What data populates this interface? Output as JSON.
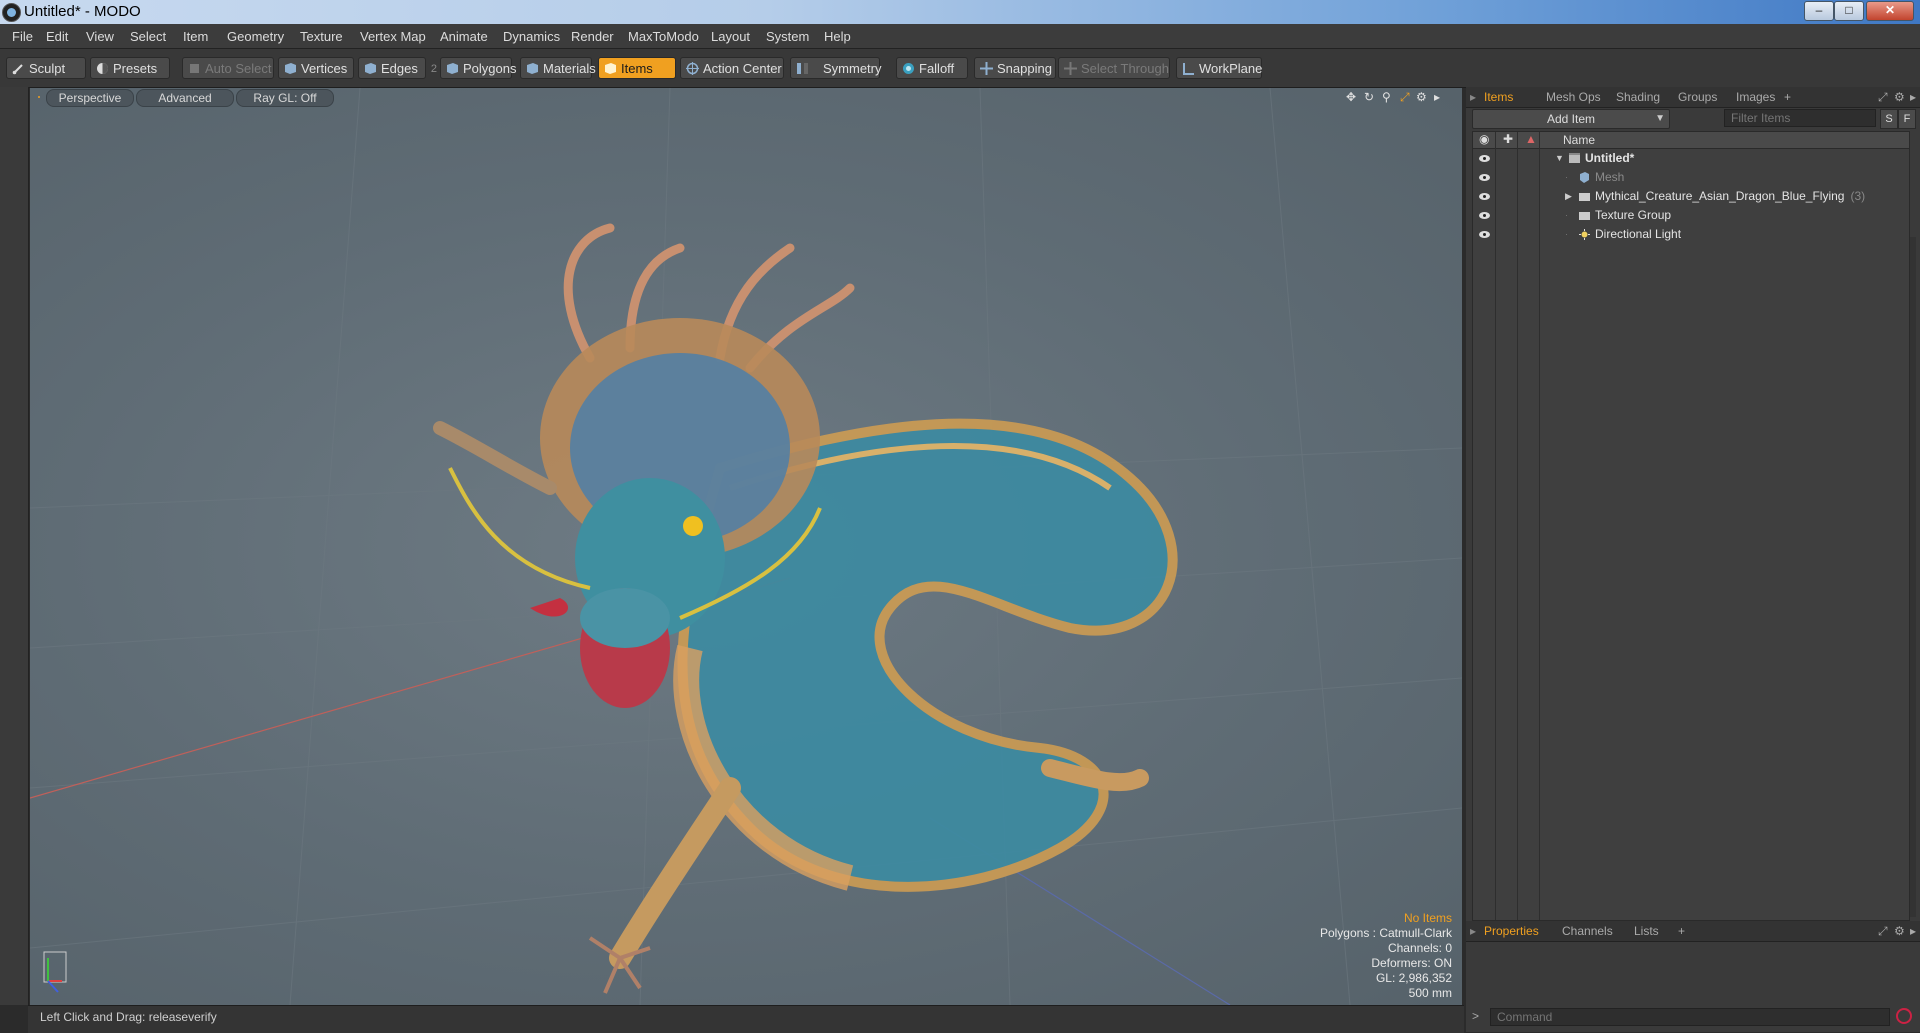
{
  "window": {
    "title": "Untitled* - MODO",
    "min": "–",
    "max": "□",
    "close": "✕"
  },
  "menu": [
    "File",
    "Edit",
    "View",
    "Select",
    "Item",
    "Geometry",
    "Texture",
    "Vertex Map",
    "Animate",
    "Dynamics",
    "Render",
    "MaxToModo",
    "Layout",
    "System",
    "Help"
  ],
  "toolbar": {
    "sculpt": "Sculpt",
    "presets": "Presets",
    "auto_select": "Auto Select",
    "vertices": "Vertices",
    "edges": "Edges",
    "edges_count": "2",
    "polygons": "Polygons",
    "materials": "Materials",
    "items": "Items",
    "action_center": "Action Center",
    "symmetry": "Symmetry",
    "falloff": "Falloff",
    "snapping": "Snapping",
    "select_through": "Select Through",
    "workplane": "WorkPlane"
  },
  "viewport": {
    "tabs": {
      "perspective": "Perspective",
      "advanced": "Advanced",
      "raygl": "Ray GL: Off"
    },
    "info": {
      "items": "No Items",
      "polygons": "Polygons : Catmull-Clark",
      "channels": "Channels: 0",
      "deformers": "Deformers: ON",
      "gl": "GL: 2,986,352",
      "scale": "500 mm"
    }
  },
  "status": {
    "hint": "Left Click and Drag:  releaseverify"
  },
  "right_panel": {
    "tabs": [
      "Items",
      "Mesh Ops",
      "Shading",
      "Groups",
      "Images",
      "+"
    ],
    "add_item": "Add Item",
    "filter_placeholder": "Filter Items",
    "s_btn": "S",
    "f_btn": "F",
    "name_header": "Name",
    "tree": {
      "root": "Untitled*",
      "mesh": "Mesh",
      "dragon": "Mythical_Creature_Asian_Dragon_Blue_Flying",
      "dragon_count": "(3)",
      "texture_group": "Texture Group",
      "light": "Directional Light"
    },
    "bottom_tabs": [
      "Properties",
      "Channels",
      "Lists",
      "+"
    ],
    "command_placeholder": "Command"
  },
  "colors": {
    "accent": "#f0a020",
    "viewport": "#637079"
  }
}
